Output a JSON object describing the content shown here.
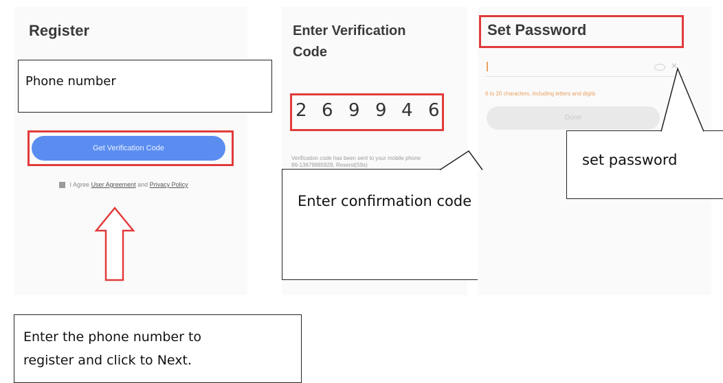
{
  "register": {
    "title": "Register",
    "phone_placeholder": "Phone number",
    "button_label": "Get Verification Code",
    "agree_prefix": "I Agree",
    "user_agreement": "User Agreement",
    "and": "and",
    "privacy_policy": "Privacy Policy"
  },
  "verify": {
    "title_line1": "Enter Verification",
    "title_line2": "Code",
    "digits": [
      "2",
      "6",
      "9",
      "9",
      "4",
      "6"
    ],
    "sent_line1": "Verification code has been sent to your mobile phone",
    "sent_line2": "86-13679885929, Resend(59s)"
  },
  "password": {
    "title": "Set Password",
    "hint": "6 to 20 characters, including letters and digits",
    "done_label": "Done"
  },
  "callouts": {
    "confirm": "Enter confirmation code",
    "set_password": "set password",
    "bottom_line1": "Enter the phone number to",
    "bottom_line2": "register and click to Next."
  },
  "colors": {
    "highlight_red": "#e23a3a",
    "button_blue": "#5b8df0",
    "hint_orange": "#e9a060"
  }
}
